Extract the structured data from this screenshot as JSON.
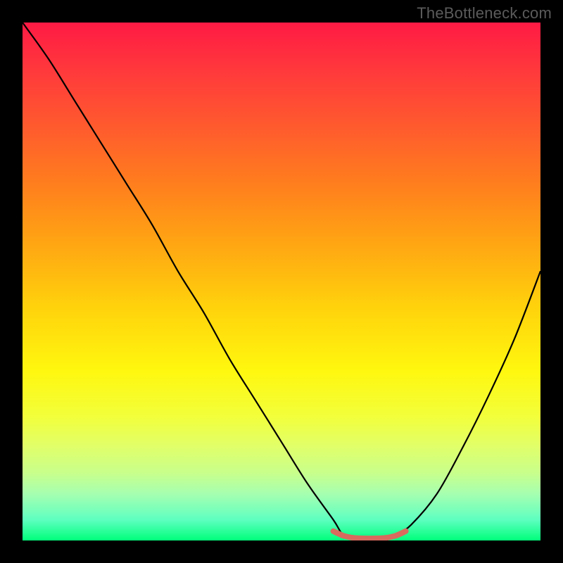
{
  "watermark": "TheBottleneck.com",
  "chart_data": {
    "type": "line",
    "title": "",
    "xlabel": "",
    "ylabel": "",
    "xlim": [
      0,
      100
    ],
    "ylim": [
      0,
      100
    ],
    "grid": false,
    "legend": false,
    "series": [
      {
        "name": "bottleneck-curve",
        "x": [
          0,
          5,
          10,
          15,
          20,
          25,
          30,
          35,
          40,
          45,
          50,
          55,
          60,
          62,
          65,
          68,
          70,
          72,
          75,
          80,
          85,
          90,
          95,
          100
        ],
        "y": [
          100,
          93,
          85,
          77,
          69,
          61,
          52,
          44,
          35,
          27,
          19,
          11,
          4,
          1,
          0,
          0,
          0,
          1,
          3,
          9,
          18,
          28,
          39,
          52
        ]
      },
      {
        "name": "target-band",
        "x": [
          60,
          62,
          64,
          66,
          68,
          70,
          72,
          74
        ],
        "y": [
          1.8,
          0.9,
          0.5,
          0.4,
          0.4,
          0.5,
          0.9,
          1.8
        ]
      }
    ],
    "annotations": []
  },
  "colors": {
    "curve": "#000000",
    "band": "#d86a5e",
    "frame": "#000000"
  }
}
